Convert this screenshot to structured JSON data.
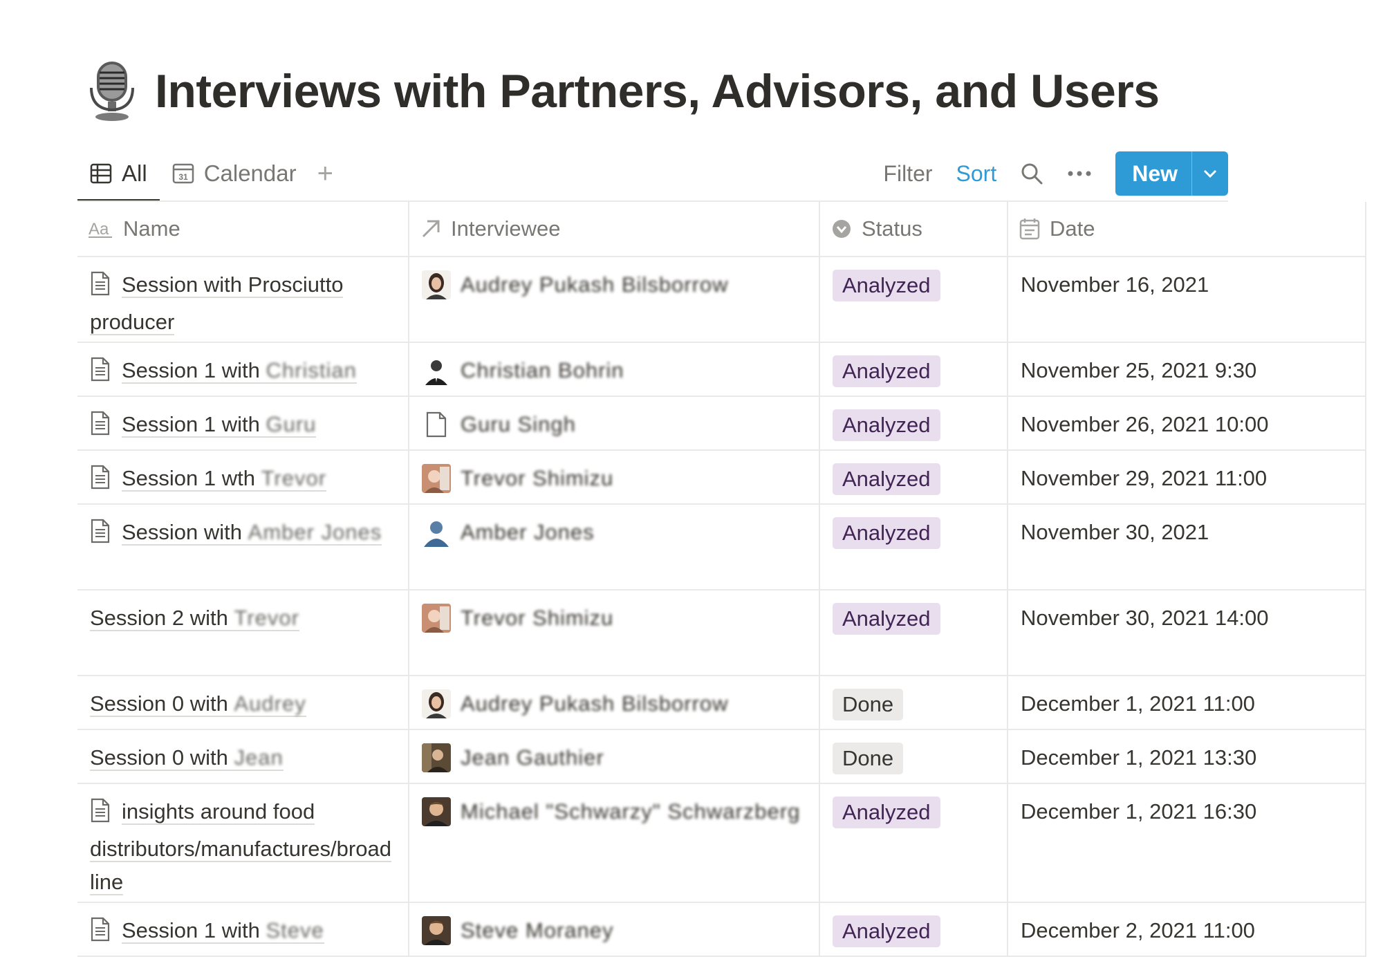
{
  "page": {
    "title": "Interviews with Partners, Advisors, and Users",
    "icon": "microphone-icon"
  },
  "views": [
    {
      "label": "All",
      "icon": "table-icon",
      "active": true
    },
    {
      "label": "Calendar",
      "icon": "calendar-icon",
      "active": false
    }
  ],
  "toolbar": {
    "filter_label": "Filter",
    "sort_label": "Sort",
    "new_label": "New",
    "accent_color": "#2f9bd6"
  },
  "columns": [
    {
      "label": "Name",
      "icon": "text-property-icon"
    },
    {
      "label": "Interviewee",
      "icon": "relation-arrow-icon"
    },
    {
      "label": "Status",
      "icon": "status-icon"
    },
    {
      "label": "Date",
      "icon": "date-icon"
    }
  ],
  "rows": [
    {
      "name_prefix": "Session with Prosciutto producer",
      "name_hidden": "",
      "has_doc_icon": true,
      "interviewee": "Audrey Pukash Bilsborrow",
      "avatar": "woman",
      "status": "Analyzed",
      "date": "November 16, 2021"
    },
    {
      "name_prefix": "Session 1 with ",
      "name_hidden": "Christian",
      "has_doc_icon": true,
      "interviewee": "Christian Bohrin",
      "avatar": "man-suit",
      "status": "Analyzed",
      "date": "November 25, 2021 9:30"
    },
    {
      "name_prefix": "Session 1 with ",
      "name_hidden": "Guru",
      "has_doc_icon": true,
      "interviewee": "Guru Singh",
      "avatar": "page",
      "status": "Analyzed",
      "date": "November 26, 2021 10:00"
    },
    {
      "name_prefix": "Session 1 wth ",
      "name_hidden": "Trevor",
      "has_doc_icon": true,
      "interviewee": "Trevor Shimizu",
      "avatar": "photo-warm",
      "status": "Analyzed",
      "date": "November 29, 2021 11:00"
    },
    {
      "name_prefix": "Session with ",
      "name_hidden": "Amber Jones",
      "has_doc_icon": true,
      "interviewee": "Amber Jones",
      "avatar": "silhouette",
      "status": "Analyzed",
      "date": "November 30, 2021"
    },
    {
      "name_prefix": "Session 2 with ",
      "name_hidden": "Trevor",
      "has_doc_icon": false,
      "interviewee": "Trevor Shimizu",
      "avatar": "photo-warm",
      "status": "Analyzed",
      "date": "November 30, 2021 14:00"
    },
    {
      "name_prefix": "Session 0 with ",
      "name_hidden": "Audrey",
      "has_doc_icon": false,
      "interviewee": "Audrey Pukash Bilsborrow",
      "avatar": "woman",
      "status": "Done",
      "date": "December 1, 2021 11:00"
    },
    {
      "name_prefix": "Session 0 with ",
      "name_hidden": "Jean",
      "has_doc_icon": false,
      "interviewee": "Jean Gauthier",
      "avatar": "photo-dark",
      "status": "Done",
      "date": "December 1, 2021 13:30"
    },
    {
      "name_prefix": "insights around food distributors/manufactures/broad line",
      "name_hidden": "",
      "has_doc_icon": true,
      "interviewee": "Michael \"Schwarzy\" Schwarzberg",
      "avatar": "photo-man",
      "status": "Analyzed",
      "date": "December 1, 2021 16:30"
    },
    {
      "name_prefix": "Session 1 with ",
      "name_hidden": "Steve",
      "has_doc_icon": true,
      "interviewee": "Steve Moraney",
      "avatar": "photo-man",
      "status": "Analyzed",
      "date": "December 2, 2021 11:00"
    }
  ],
  "status_colors": {
    "Analyzed": "#e8deee",
    "Done": "#ebeae8"
  }
}
